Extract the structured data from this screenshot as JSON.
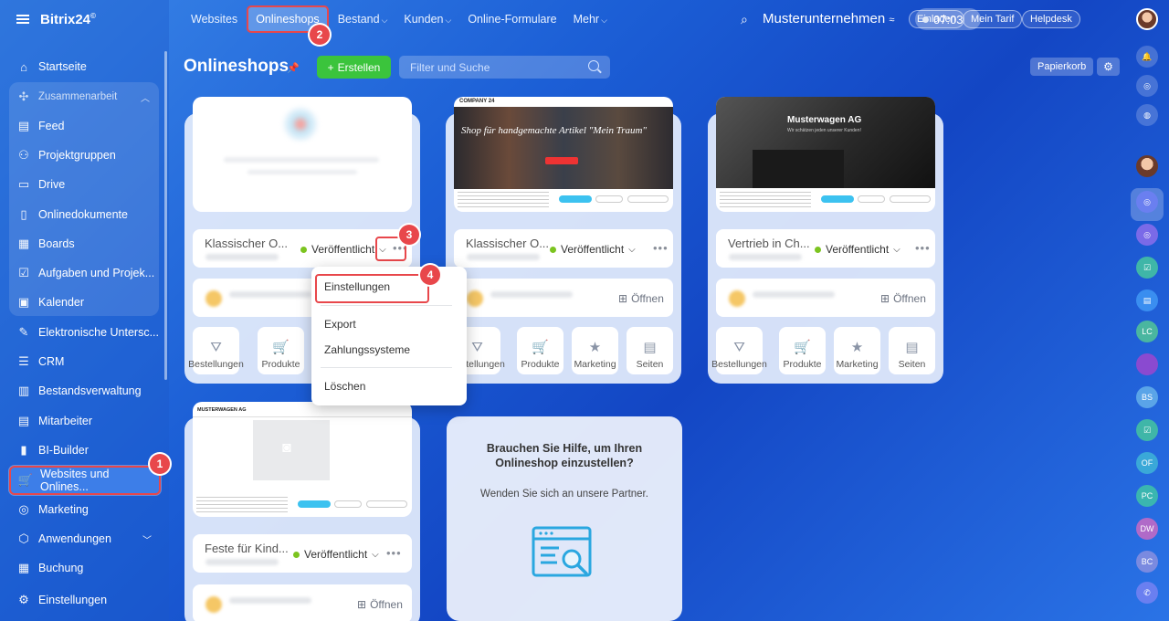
{
  "app": {
    "logo": "Bitrix24",
    "logo_mark": "©"
  },
  "sidebar": {
    "items": [
      {
        "label": "Startseite",
        "icon": "home-icon"
      },
      {
        "label": "Zusammenarbeit",
        "icon": "collab-icon"
      },
      {
        "label": "Feed",
        "icon": "feed-icon"
      },
      {
        "label": "Projektgruppen",
        "icon": "groups-icon"
      },
      {
        "label": "Drive",
        "icon": "drive-icon"
      },
      {
        "label": "Onlinedokumente",
        "icon": "docs-icon"
      },
      {
        "label": "Boards",
        "icon": "boards-icon"
      },
      {
        "label": "Aufgaben und Projek...",
        "icon": "tasks-icon"
      },
      {
        "label": "Kalender",
        "icon": "calendar-icon"
      },
      {
        "label": "Elektronische Untersc...",
        "icon": "signature-icon"
      },
      {
        "label": "CRM",
        "icon": "crm-icon"
      },
      {
        "label": "Bestandsverwaltung",
        "icon": "inventory-icon"
      },
      {
        "label": "Mitarbeiter",
        "icon": "employees-icon"
      },
      {
        "label": "BI-Builder",
        "icon": "bi-icon"
      },
      {
        "label": "Websites und Onlines...",
        "icon": "cart-icon"
      },
      {
        "label": "Marketing",
        "icon": "marketing-icon"
      },
      {
        "label": "Anwendungen",
        "icon": "apps-icon"
      },
      {
        "label": "Buchung",
        "icon": "booking-icon"
      },
      {
        "label": "Einstellungen",
        "icon": "settings-icon"
      }
    ]
  },
  "topnav": {
    "items": [
      "Websites",
      "Onlineshops",
      "Bestand",
      "Kunden",
      "Online-Formulare",
      "Mehr"
    ],
    "company": "Musterunternehmen",
    "invite": "Einladen",
    "plan": "Mein Tarif",
    "helpdesk": "Helpdesk",
    "time": "07:03"
  },
  "rightbar": {
    "initials": [
      "LC",
      "BS",
      "OF",
      "PC",
      "DW",
      "BC"
    ]
  },
  "page": {
    "title": "Onlineshops",
    "create_label": "Erstellen",
    "search_placeholder": "Filter und Suche",
    "trash_label": "Papierkorb"
  },
  "shops": [
    {
      "title": "Klassischer O...",
      "status": "Veröffentlicht"
    },
    {
      "title": "Klassischer O...",
      "status": "Veröffentlicht",
      "open": "Öffnen"
    },
    {
      "title": "Vertrieb in Ch...",
      "status": "Veröffentlicht",
      "open": "Öffnen"
    },
    {
      "title": "Feste für Kind...",
      "status": "Veröffentlicht",
      "open": "Öffnen"
    }
  ],
  "tiles": [
    "Bestellungen",
    "Produkte",
    "Marketing",
    "Seiten"
  ],
  "previews": {
    "company24": "COMPANY 24",
    "shop_heading": "Shop für handgemachte Artikel \"Mein Traum\"",
    "musterwagen": "Musterwagen AG",
    "musterwagen_upper": "MUSTERWAGEN AG",
    "musterwagen_sub": "Wir schätzen jeden unserer Kunden!"
  },
  "context_menu": {
    "items": [
      "Einstellungen",
      "Export",
      "Zahlungssysteme",
      "Löschen"
    ]
  },
  "help": {
    "title": "Brauchen Sie Hilfe, um Ihren Onlineshop einzustellen?",
    "subtitle": "Wenden Sie sich an unsere Partner."
  },
  "badges": [
    "1",
    "2",
    "3",
    "4"
  ],
  "colors": {
    "accent_green": "#3bc43c",
    "highlight_red": "#e8474b",
    "status_green": "#7cc420"
  }
}
